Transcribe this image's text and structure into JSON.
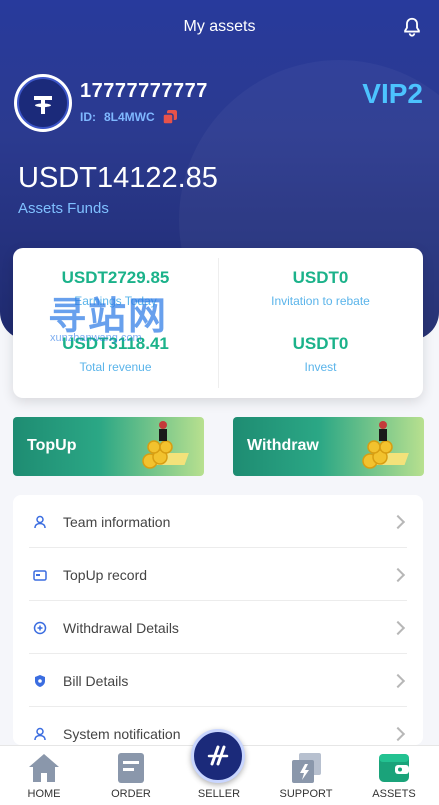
{
  "header": {
    "title": "My assets"
  },
  "profile": {
    "phone": "17777777777",
    "id_label": "ID:",
    "id_value": "8L4MWC",
    "vip": "VIP2"
  },
  "balance": {
    "amount": "USDT14122.85",
    "label": "Assets Funds"
  },
  "stats": [
    {
      "value": "USDT2729.85",
      "label": "Earnings Today"
    },
    {
      "value": "USDT0",
      "label": "Invitation to rebate"
    },
    {
      "value": "USDT3118.41",
      "label": "Total revenue"
    },
    {
      "value": "USDT0",
      "label": "Invest"
    }
  ],
  "watermark": {
    "text": "寻站网",
    "sub": "xunzhanwang.com"
  },
  "actions": {
    "topup": "TopUp",
    "withdraw": "Withdraw"
  },
  "menu": [
    {
      "label": "Team information",
      "icon": "team-icon"
    },
    {
      "label": "TopUp record",
      "icon": "card-icon"
    },
    {
      "label": "Withdrawal Details",
      "icon": "withdraw-icon"
    },
    {
      "label": "Bill Details",
      "icon": "shield-icon"
    },
    {
      "label": "System notification",
      "icon": "user-icon"
    }
  ],
  "tabs": [
    {
      "label": "HOME",
      "icon": "home-icon"
    },
    {
      "label": "ORDER",
      "icon": "order-icon"
    },
    {
      "label": "SELLER",
      "icon": "seller-icon"
    },
    {
      "label": "SUPPORT",
      "icon": "support-icon"
    },
    {
      "label": "ASSETS",
      "icon": "wallet-icon"
    }
  ],
  "colors": {
    "hero": "#283a9c",
    "accent_green": "#1bb28a",
    "accent_blue": "#5ab4ea",
    "vip": "#4cc3ff"
  }
}
